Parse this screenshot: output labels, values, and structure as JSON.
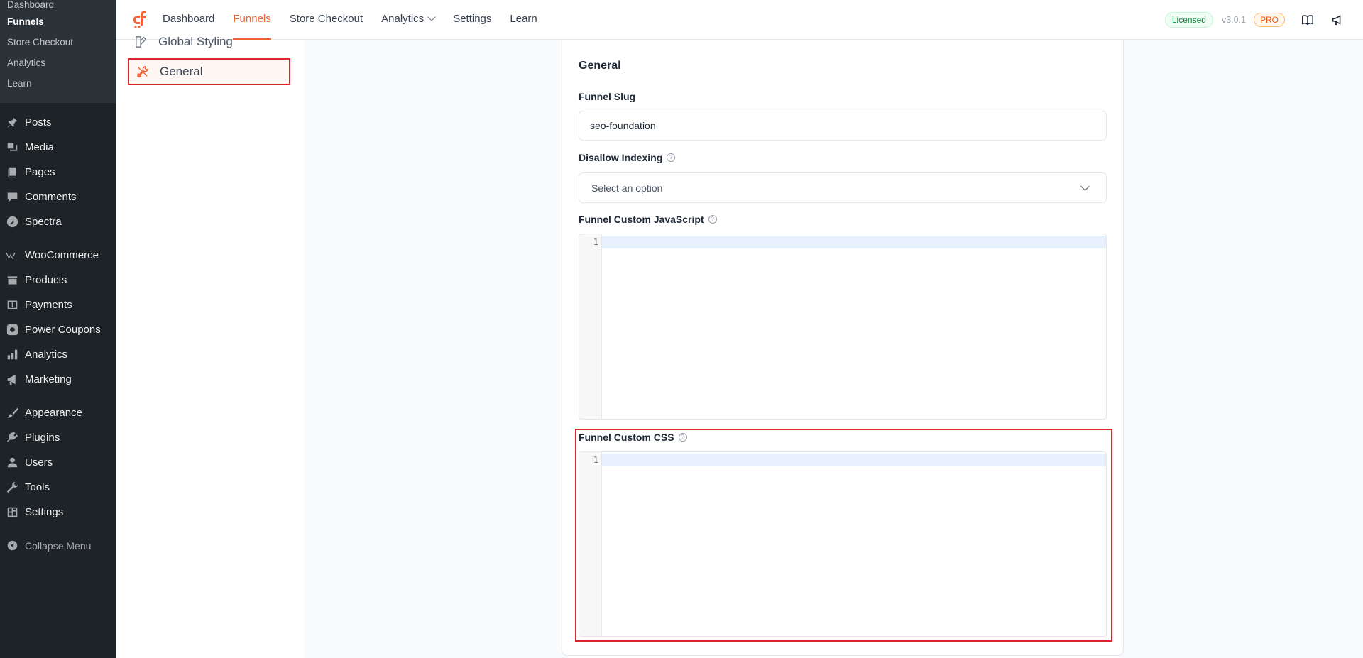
{
  "wp_submenu": {
    "items": [
      {
        "label": "Dashboard",
        "current": false
      },
      {
        "label": "Funnels",
        "current": true
      },
      {
        "label": "Store Checkout",
        "current": false
      },
      {
        "label": "Analytics",
        "current": false
      },
      {
        "label": "Learn",
        "current": false
      }
    ]
  },
  "wp_menu": {
    "posts": "Posts",
    "media": "Media",
    "pages": "Pages",
    "comments": "Comments",
    "spectra": "Spectra",
    "woocommerce": "WooCommerce",
    "products": "Products",
    "payments": "Payments",
    "power_coupons": "Power Coupons",
    "analytics": "Analytics",
    "marketing": "Marketing",
    "appearance": "Appearance",
    "plugins": "Plugins",
    "users": "Users",
    "tools": "Tools",
    "settings": "Settings",
    "collapse": "Collapse Menu"
  },
  "topnav": {
    "dashboard": "Dashboard",
    "funnels": "Funnels",
    "store_checkout": "Store Checkout",
    "analytics": "Analytics",
    "settings": "Settings",
    "learn": "Learn",
    "licensed": "Licensed",
    "version": "v3.0.1",
    "pro": "PRO"
  },
  "settings_nav": {
    "global_styling": "Global Styling",
    "general": "General"
  },
  "card": {
    "title": "General",
    "slug_label": "Funnel Slug",
    "slug_value": "seo-foundation",
    "indexing_label": "Disallow Indexing",
    "indexing_placeholder": "Select an option",
    "js_label": "Funnel Custom JavaScript",
    "css_label": "Funnel Custom CSS",
    "line_number": "1"
  },
  "colors": {
    "accent": "#f06335",
    "highlight": "#d9262e",
    "wp_sidebar": "#1d2327"
  }
}
